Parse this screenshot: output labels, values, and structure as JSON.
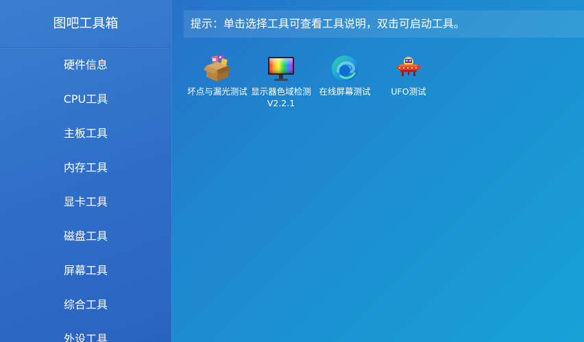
{
  "sidebar": {
    "title": "图吧工具箱",
    "items": [
      {
        "label": "硬件信息"
      },
      {
        "label": "CPU工具"
      },
      {
        "label": "主板工具"
      },
      {
        "label": "内存工具"
      },
      {
        "label": "显卡工具"
      },
      {
        "label": "磁盘工具"
      },
      {
        "label": "屏幕工具"
      },
      {
        "label": "综合工具"
      },
      {
        "label": "外设工具"
      }
    ]
  },
  "tip": "提示：单击选择工具可查看工具说明，双击可启动工具。",
  "tools": [
    {
      "label": "坏点与漏光测试",
      "icon": "cardboard-box-icon"
    },
    {
      "label": "显示器色域检测V2.2.1",
      "icon": "color-monitor-icon"
    },
    {
      "label": "在线屏幕测试",
      "icon": "edge-browser-icon"
    },
    {
      "label": "UFO测试",
      "icon": "ufo-icon"
    }
  ]
}
